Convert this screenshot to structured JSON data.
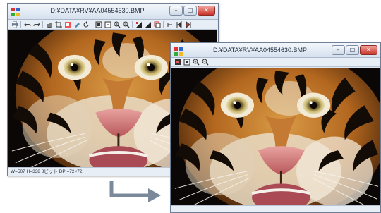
{
  "colors": {
    "arrow": "#7b8a9b",
    "titlebar": "#d5e0ee",
    "close_button": "#c8352b"
  },
  "window_primary": {
    "title": "D:¥DATA¥RV¥AA04554630.BMP",
    "controls": {
      "minimize": "–",
      "maximize": "□",
      "close": "✕"
    },
    "toolbar_icons": [
      "print-icon",
      "undo-icon",
      "redo-icon",
      "hand-icon",
      "crop-icon",
      "adjust-icon",
      "paint-icon",
      "rotate-icon",
      "fit-icon",
      "actual-size-icon",
      "zoom-in-icon",
      "zoom-out-icon",
      "mask-icon",
      "contrast-icon",
      "copy-icon",
      "step-icon",
      "previous-icon",
      "next-icon"
    ],
    "status": "W=507 H=338 8ビット DPI=72×72",
    "image": "tiger-face"
  },
  "window_secondary": {
    "title": "D:¥DATA¥RV¥AA04554630.BMP",
    "controls": {
      "minimize": "–",
      "maximize": "□",
      "close": "✕"
    },
    "toolbar_icons": [
      "open-icon",
      "fit-icon",
      "zoom-in-icon",
      "zoom-out-icon"
    ],
    "status": "",
    "image": "tiger-face"
  }
}
